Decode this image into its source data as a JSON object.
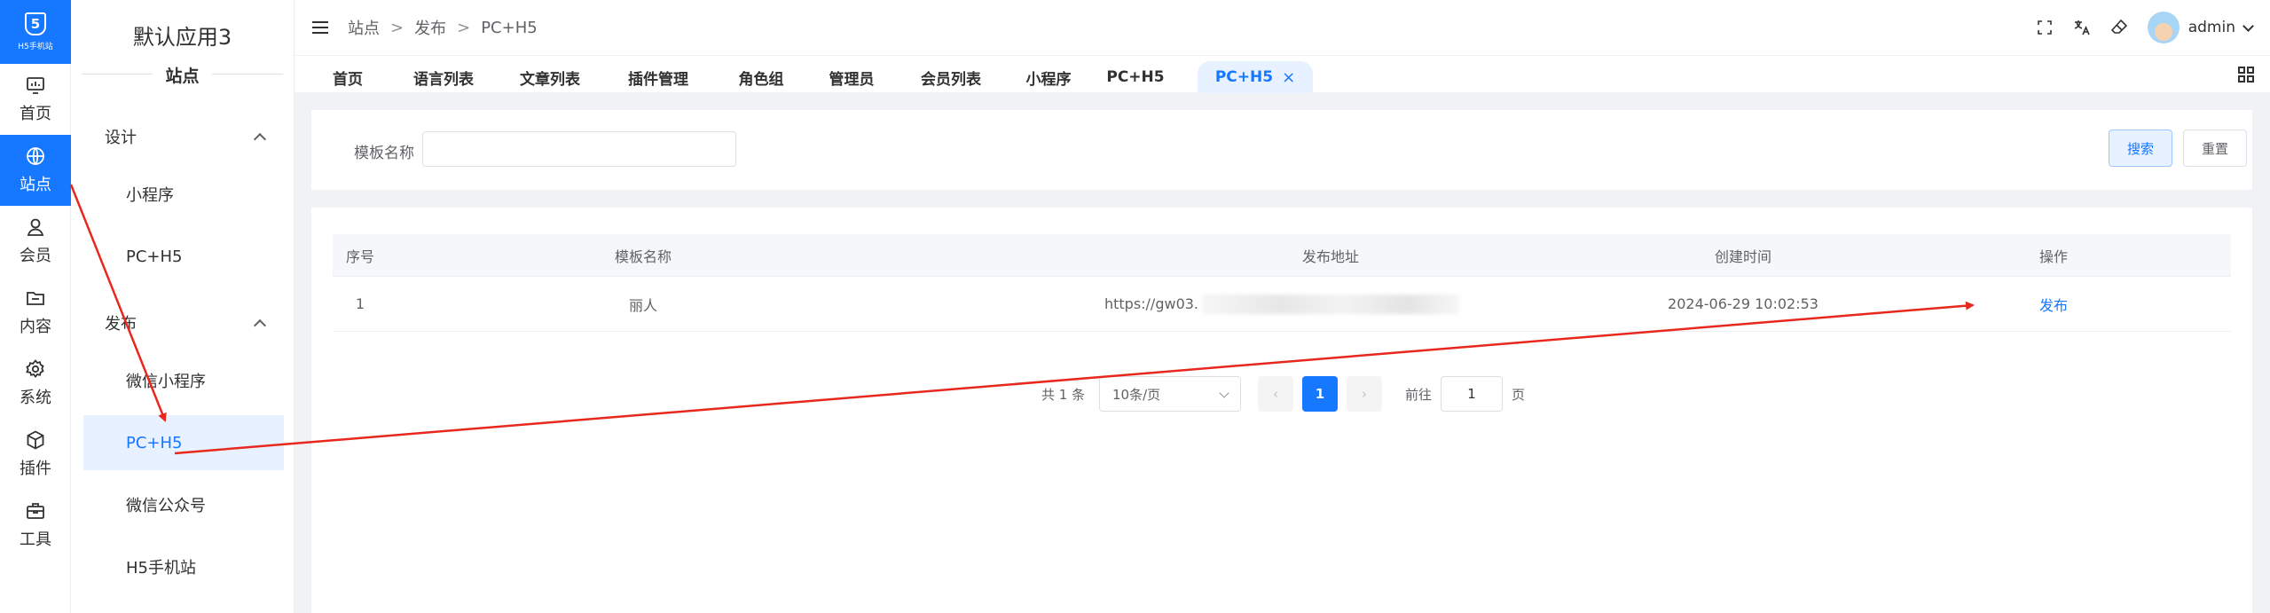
{
  "logo": {
    "mark": "5",
    "text": "H5手机站"
  },
  "rail": [
    {
      "label": "首页",
      "icon": "dashboard-icon"
    },
    {
      "label": "站点",
      "icon": "globe-icon",
      "active": true
    },
    {
      "label": "会员",
      "icon": "user-icon"
    },
    {
      "label": "内容",
      "icon": "folder-icon"
    },
    {
      "label": "系统",
      "icon": "gear-icon"
    },
    {
      "label": "插件",
      "icon": "cube-icon"
    },
    {
      "label": "工具",
      "icon": "toolbox-icon"
    }
  ],
  "submenu": {
    "app_name": "默认应用3",
    "section": "站点",
    "group_design": "设计",
    "group_publish": "发布",
    "items": [
      "小程序",
      "PC+H5",
      "微信小程序",
      "PC+H5",
      "微信公众号",
      "H5手机站"
    ]
  },
  "breadcrumb": [
    "站点",
    "发布",
    "PC+H5"
  ],
  "breadcrumb_sep": ">",
  "user": {
    "name": "admin"
  },
  "tabs": [
    "首页",
    "语言列表",
    "文章列表",
    "插件管理",
    "角色组",
    "管理员",
    "会员列表",
    "小程序",
    "PC+H5",
    "PC+H5"
  ],
  "tab_close": "×",
  "search": {
    "label": "模板名称",
    "value": "",
    "search_btn": "搜索",
    "reset_btn": "重置"
  },
  "table": {
    "columns": [
      "序号",
      "模板名称",
      "发布地址",
      "创建时间",
      "操作"
    ],
    "rows": [
      {
        "index": "1",
        "name": "丽人",
        "url": "https://gw03.",
        "created": "2024-06-29 10:02:53",
        "action": "发布"
      }
    ]
  },
  "pagination": {
    "total": "共 1 条",
    "page_size": "10条/页",
    "prev": "‹",
    "current": "1",
    "next": "›",
    "goto_label": "前往",
    "goto_value": "1",
    "page_unit": "页"
  },
  "colors": {
    "primary": "#1677ff",
    "annotation": "#e8281e"
  }
}
